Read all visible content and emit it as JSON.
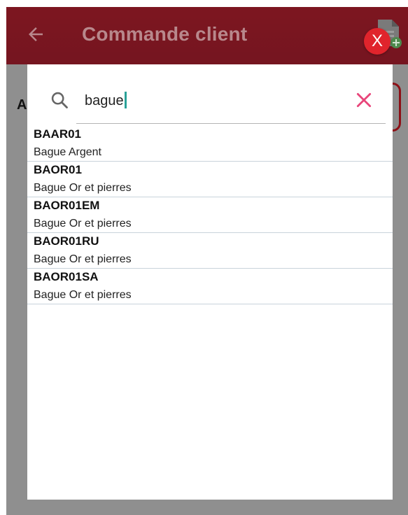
{
  "header": {
    "title": "Commande client",
    "back_icon": "arrow-left-icon",
    "doc_icon": "document-add-icon",
    "close_label": "X"
  },
  "background": {
    "partial_label": "A"
  },
  "search": {
    "value": "bague",
    "search_icon": "search-icon",
    "clear_icon": "close-icon"
  },
  "results": [
    {
      "code": "BAAR01",
      "name": "Bague Argent"
    },
    {
      "code": "BAOR01",
      "name": "Bague Or et pierres"
    },
    {
      "code": "BAOR01EM",
      "name": "Bague Or et pierres"
    },
    {
      "code": "BAOR01RU",
      "name": "Bague Or et pierres"
    },
    {
      "code": "BAOR01SA",
      "name": "Bague Or et pierres"
    }
  ],
  "colors": {
    "header": "#7d1620",
    "accent_red": "#e0242c",
    "clear_pink": "#e8457a",
    "caret_teal": "#2aa198"
  }
}
